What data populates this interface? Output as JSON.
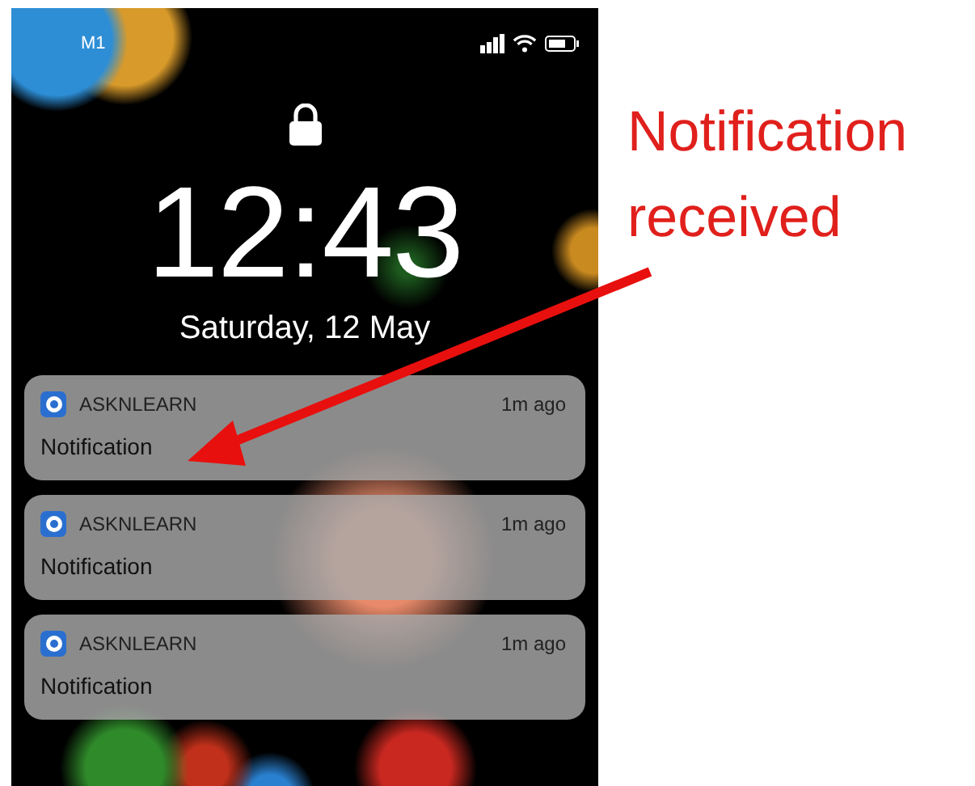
{
  "status_bar": {
    "carrier": "M1"
  },
  "lock_screen": {
    "time": "12:43",
    "date": "Saturday, 12 May"
  },
  "notifications": [
    {
      "app": "ASKNLEARN",
      "time": "1m ago",
      "message": "Notification"
    },
    {
      "app": "ASKNLEARN",
      "time": "1m ago",
      "message": "Notification"
    },
    {
      "app": "ASKNLEARN",
      "time": "1m ago",
      "message": "Notification"
    }
  ],
  "annotation": {
    "text": "Notification received"
  }
}
